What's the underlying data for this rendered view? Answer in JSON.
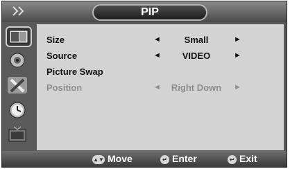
{
  "header": {
    "title": "PIP",
    "back_icon": "double-chevron-right-icon"
  },
  "sidebar": {
    "items": [
      {
        "icon": "picture-icon"
      },
      {
        "icon": "sound-icon"
      },
      {
        "icon": "setup-tools-icon"
      },
      {
        "icon": "clock-icon"
      },
      {
        "icon": "input-tv-icon"
      }
    ]
  },
  "menu": {
    "rows": [
      {
        "label": "Size",
        "value": "Small",
        "left_arrow": "◄",
        "right_arrow": "►",
        "enabled": true
      },
      {
        "label": "Source",
        "value": "VIDEO",
        "left_arrow": "◄",
        "right_arrow": "►",
        "enabled": true
      },
      {
        "label": "Picture Swap",
        "value": "",
        "enabled": true
      },
      {
        "label": "Position",
        "value": "Right Down",
        "left_arrow": "◄",
        "right_arrow": "►",
        "enabled": false
      }
    ]
  },
  "footer": {
    "move_label": "Move",
    "enter_label": "Enter",
    "exit_label": "Exit"
  },
  "colors": {
    "panel": "#d3d3d3",
    "frame": "#5a5a5a",
    "disabled_text": "#8e8e8e"
  }
}
